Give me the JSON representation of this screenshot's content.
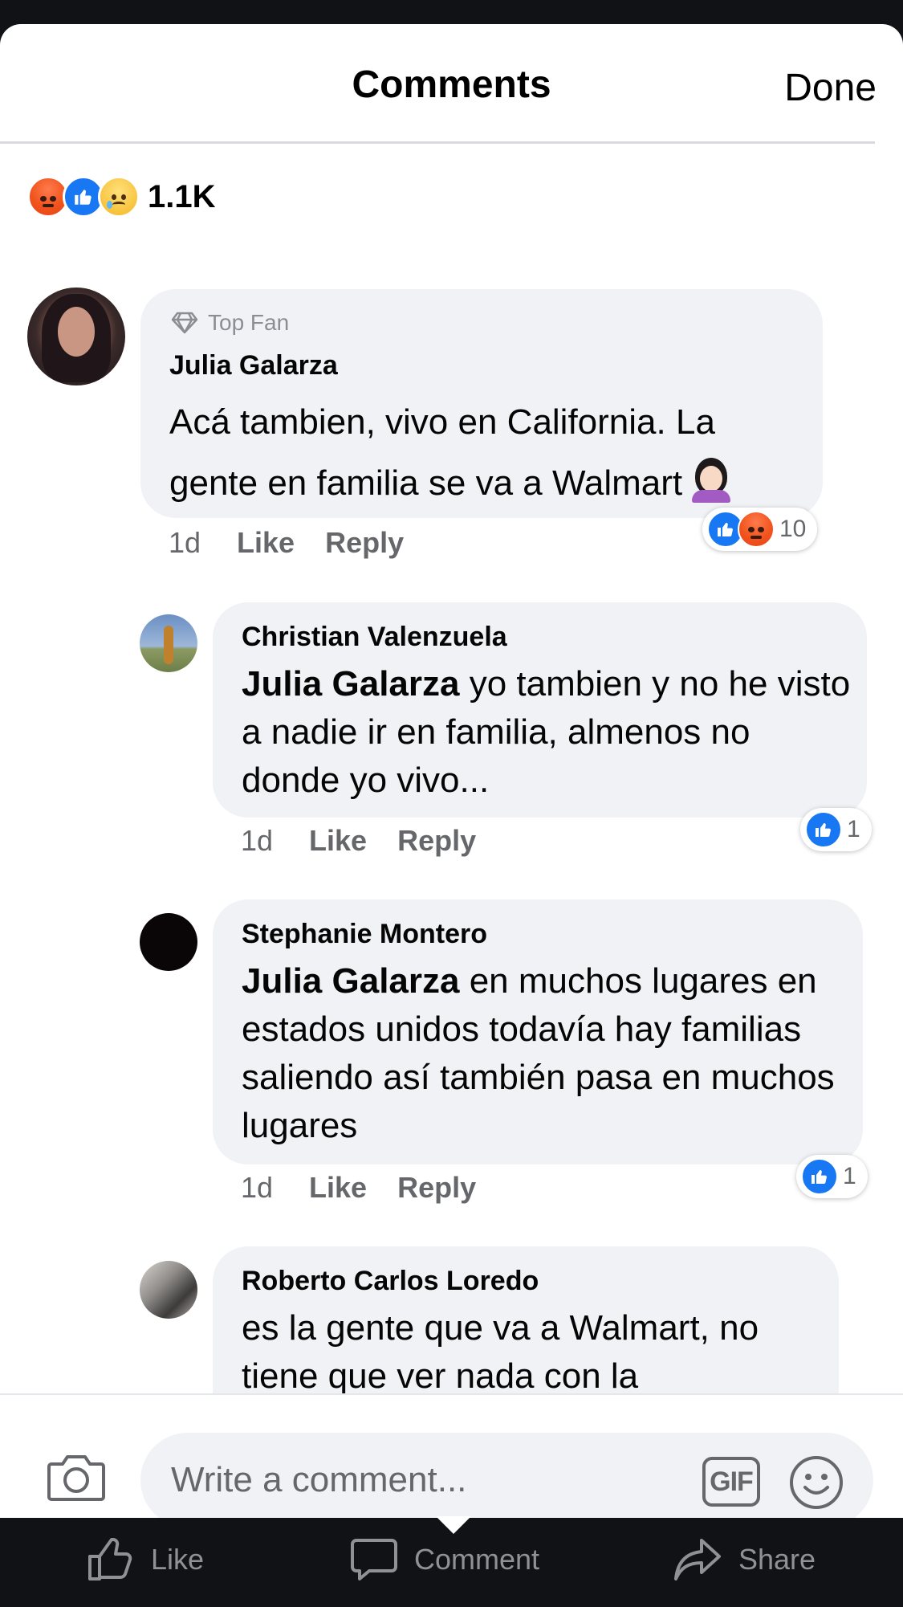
{
  "header": {
    "title": "Comments",
    "done_label": "Done"
  },
  "summary": {
    "reactions": [
      "angry",
      "like",
      "sad"
    ],
    "count": "1.1K"
  },
  "comments": [
    {
      "badge": "Top Fan",
      "author": "Julia Galarza",
      "text": "Acá tambien, vivo en California. La gente en familia se va a Walmart",
      "emoji": "woman-facepalming",
      "time": "1d",
      "like_label": "Like",
      "reply_label": "Reply",
      "reactions": [
        "like",
        "angry"
      ],
      "reaction_count": "10"
    },
    {
      "author": "Christian Valenzuela",
      "mention": "Julia Galarza",
      "text": " yo tambien y no he visto a nadie ir en familia, almenos no donde yo vivo...",
      "time": "1d",
      "like_label": "Like",
      "reply_label": "Reply",
      "reactions": [
        "like"
      ],
      "reaction_count": "1"
    },
    {
      "author": "Stephanie Montero",
      "mention": "Julia Galarza",
      "text": " en muchos lugares en estados unidos todavía hay familias saliendo así también pasa en muchos lugares",
      "time": "1d",
      "like_label": "Like",
      "reply_label": "Reply",
      "reactions": [
        "like"
      ],
      "reaction_count": "1"
    },
    {
      "author": "Roberto Carlos Loredo",
      "text": "es la gente que va a Walmart, no tiene que ver nada con la"
    }
  ],
  "composer": {
    "placeholder": "Write a comment...",
    "gif_label": "GIF"
  },
  "tabbar": {
    "like_label": "Like",
    "comment_label": "Comment",
    "share_label": "Share"
  },
  "colors": {
    "accent": "#1877f2",
    "bubble": "#f0f2f5",
    "meta": "#65676b",
    "angry": "#f1541d"
  }
}
